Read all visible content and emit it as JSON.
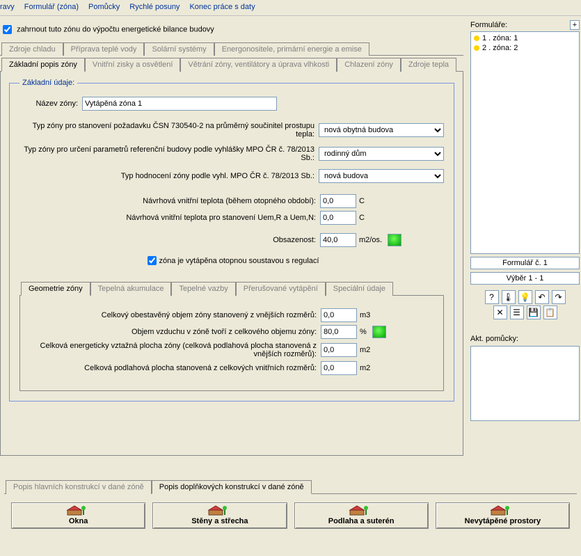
{
  "menu": {
    "items": [
      "ravy",
      "Formulář (zóna)",
      "Pomůcky",
      "Rychlé posuny",
      "Konec práce s daty"
    ]
  },
  "include_zone_checkbox": "zahrnout tuto zónu do výpočtu energetické bilance budovy",
  "top_tabs": [
    {
      "label": "Zdroje chladu",
      "dim": true
    },
    {
      "label": "Příprava teplé vody"
    },
    {
      "label": "Solární systémy"
    },
    {
      "label": "Energonositele, primární energie a emise"
    }
  ],
  "second_tabs": [
    {
      "label": "Základní popis zóny",
      "active": true
    },
    {
      "label": "Vnitřní zisky a osvětlení"
    },
    {
      "label": "Větrání zóny, ventilátory a úprava vlhkosti"
    },
    {
      "label": "Chlazení zóny"
    },
    {
      "label": "Zdroje tepla"
    }
  ],
  "basic": {
    "legend": "Základní údaje:",
    "name_label": "Název zóny:",
    "name_value": "Vytápěná zóna 1",
    "type1_label": "Typ zóny pro stanovení požadavku ČSN 730540-2 na průměrný součinitel prostupu tepla:",
    "type1_value": "nová obytná budova",
    "type2_label": "Typ zóny pro určení parametrů referenční budovy podle vyhlášky MPO ČR č. 78/2013 Sb.:",
    "type2_value": "rodinný dům",
    "type3_label": "Typ hodnocení zóny podle vyhl. MPO ČR č. 78/2013 Sb.:",
    "type3_value": "nová budova",
    "temp1_label": "Návrhová vnitřní teplota (během otopného období):",
    "temp1_value": "0,0",
    "temp1_unit": "C",
    "temp2_label": "Návrhová vnitřní teplota pro stanovení Uem,R a Uem,N:",
    "temp2_value": "0,0",
    "temp2_unit": "C",
    "occ_label": "Obsazenost:",
    "occ_value": "40,0",
    "occ_unit": "m2/os.",
    "heated_chk": "zóna je vytápěna otopnou soustavou s regulací"
  },
  "sub_tabs": [
    {
      "label": "Geometrie zóny",
      "active": true
    },
    {
      "label": "Tepelná akumulace"
    },
    {
      "label": "Tepelné vazby"
    },
    {
      "label": "Přerušované vytápění"
    },
    {
      "label": "Speciální údaje"
    }
  ],
  "geom": {
    "vol_label": "Celkový obestavěný objem zóny stanovený z vnějších rozměrů:",
    "vol_value": "0,0",
    "vol_unit": "m3",
    "air_label": "Objem vzduchu v zóně tvoří z celkového objemu zóny:",
    "air_value": "80,0",
    "air_unit": "%",
    "area1_label": "Celková energeticky vztažná plocha zóny (celková podlahová plocha stanovená z vnějších rozměrů):",
    "area1_value": "0,0",
    "area1_unit": "m2",
    "area2_label": "Celková podlahová plocha stanovená z celkových vnitřních rozměrů:",
    "area2_value": "0,0",
    "area2_unit": "m2"
  },
  "right": {
    "title": "Formuláře:",
    "items": [
      "1 . zóna: 1",
      "2 . zóna: 2"
    ],
    "form_btn": "Formulář č. 1",
    "vyber_btn": "Výběr 1 - 1",
    "pomucky_label": "Akt. pomůcky:"
  },
  "bottom_tabs": [
    {
      "label": "Popis hlavních konstrukcí v dané zóně"
    },
    {
      "label": "Popis doplňkových konstrukcí v dané zóně",
      "active": true
    }
  ],
  "big_buttons": [
    {
      "label": "Okna"
    },
    {
      "label": "Stěny a střecha"
    },
    {
      "label": "Podlaha a suterén"
    },
    {
      "label": "Nevytápěné prostory"
    }
  ]
}
